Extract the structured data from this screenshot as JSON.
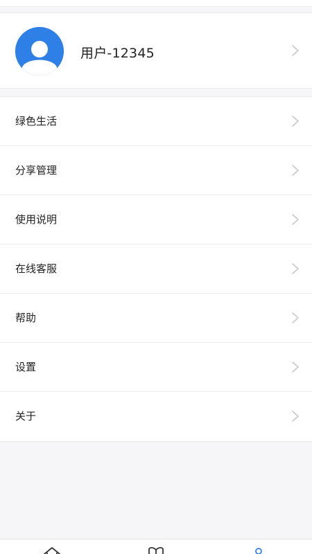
{
  "profile": {
    "name": "用户-12345",
    "avatar_color": "#2f80e6"
  },
  "menu": {
    "items": [
      {
        "label": "绿色生活"
      },
      {
        "label": "分享管理"
      },
      {
        "label": "使用说明"
      },
      {
        "label": "在线客服"
      },
      {
        "label": "帮助"
      },
      {
        "label": "设置"
      },
      {
        "label": "关于"
      }
    ]
  },
  "tabbar": {
    "tabs": [
      {
        "icon": "home-icon"
      },
      {
        "icon": "book-icon"
      },
      {
        "icon": "user-icon"
      }
    ],
    "active_color": "#2f80e6"
  }
}
